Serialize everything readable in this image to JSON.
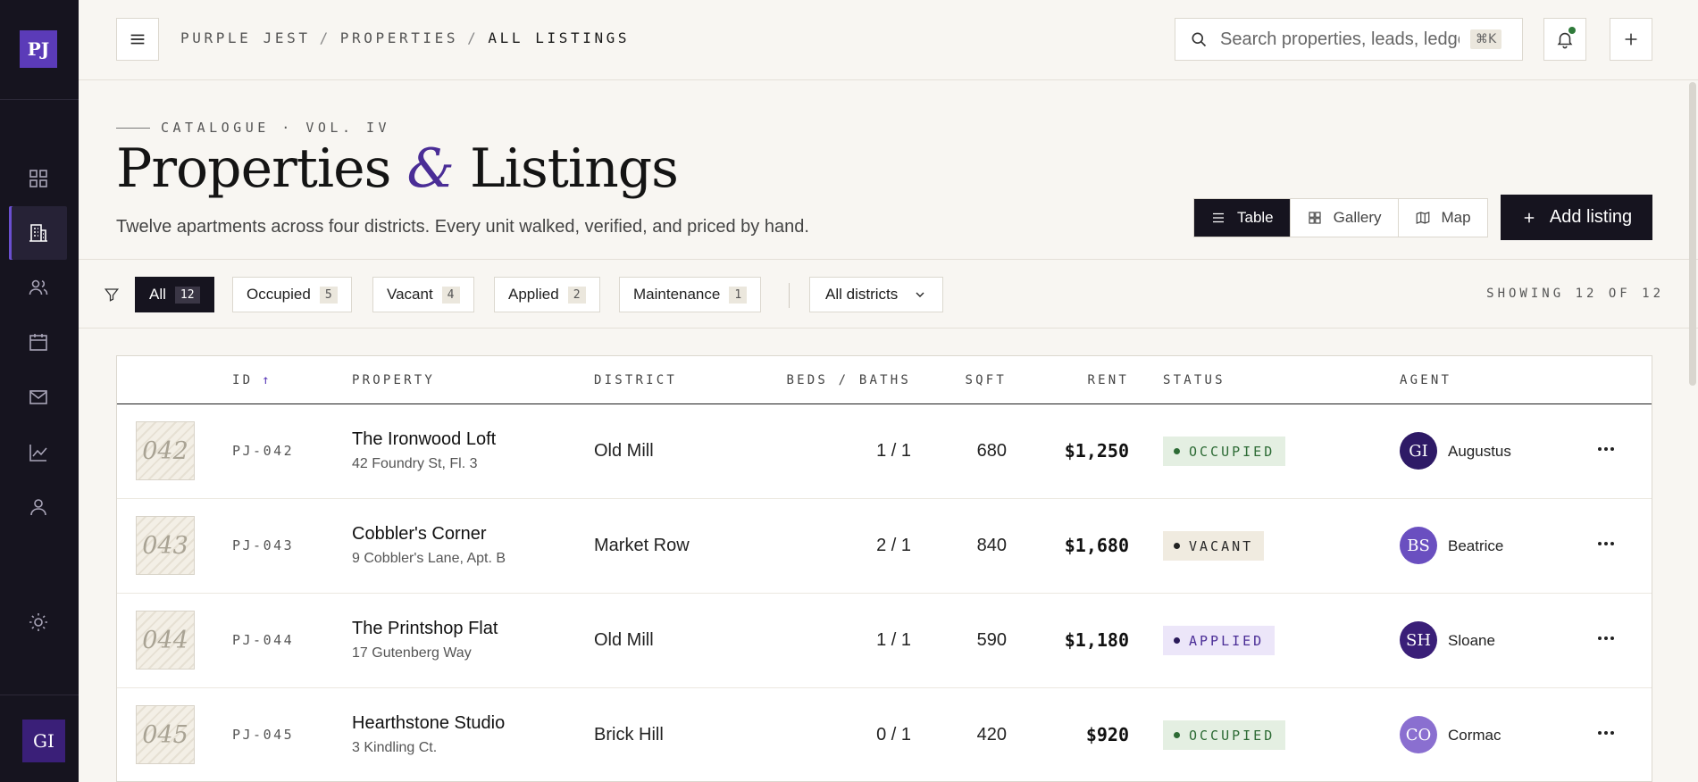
{
  "app": {
    "logo": "PJ",
    "user_initials": "GI"
  },
  "header": {
    "breadcrumb": [
      "PURPLE JEST",
      "PROPERTIES",
      "ALL LISTINGS"
    ],
    "search_placeholder": "Search properties, leads, ledgers…",
    "search_shortcut": "⌘K"
  },
  "page": {
    "kicker": "CATALOGUE · VOL. IV",
    "title_part1": "Properties",
    "title_amp": "&",
    "title_part2": "Listings",
    "subtitle": "Twelve apartments across four districts. Every unit walked, verified, and priced by hand."
  },
  "view_toggle": {
    "options": [
      {
        "label": "Table",
        "icon": "list-icon",
        "active": true
      },
      {
        "label": "Gallery",
        "icon": "grid-icon",
        "active": false
      },
      {
        "label": "Map",
        "icon": "map-icon",
        "active": false
      }
    ]
  },
  "add_button": {
    "label": "Add listing"
  },
  "filters": {
    "chips": [
      {
        "label": "All",
        "count": "12",
        "active": true
      },
      {
        "label": "Occupied",
        "count": "5",
        "active": false
      },
      {
        "label": "Vacant",
        "count": "4",
        "active": false
      },
      {
        "label": "Applied",
        "count": "2",
        "active": false
      },
      {
        "label": "Maintenance",
        "count": "1",
        "active": false
      }
    ],
    "district_selected": "All districts",
    "showing": "SHOWING 12 OF 12"
  },
  "table": {
    "columns": {
      "id": "ID",
      "property": "PROPERTY",
      "district": "DISTRICT",
      "beds_baths": "BEDS / BATHS",
      "sqft": "SQFT",
      "rent": "RENT",
      "status": "STATUS",
      "agent": "AGENT"
    },
    "sort_indicator": "↑",
    "rows": [
      {
        "thumb": "042",
        "id": "PJ-042",
        "name": "The Ironwood Loft",
        "address": "42 Foundry St, Fl. 3",
        "district": "Old Mill",
        "beds_baths": "1 / 1",
        "sqft": "680",
        "rent": "$1,250",
        "status": "OCCUPIED",
        "agent_initials": "GI",
        "agent_name": "Augustus"
      },
      {
        "thumb": "043",
        "id": "PJ-043",
        "name": "Cobbler's Corner",
        "address": "9 Cobbler's Lane, Apt. B",
        "district": "Market Row",
        "beds_baths": "2 / 1",
        "sqft": "840",
        "rent": "$1,680",
        "status": "VACANT",
        "agent_initials": "BS",
        "agent_name": "Beatrice"
      },
      {
        "thumb": "044",
        "id": "PJ-044",
        "name": "The Printshop Flat",
        "address": "17 Gutenberg Way",
        "district": "Old Mill",
        "beds_baths": "1 / 1",
        "sqft": "590",
        "rent": "$1,180",
        "status": "APPLIED",
        "agent_initials": "SH",
        "agent_name": "Sloane"
      },
      {
        "thumb": "045",
        "id": "PJ-045",
        "name": "Hearthstone Studio",
        "address": "3 Kindling Ct.",
        "district": "Brick Hill",
        "beds_baths": "0 / 1",
        "sqft": "420",
        "rent": "$920",
        "status": "OCCUPIED",
        "agent_initials": "CO",
        "agent_name": "Cormac"
      }
    ]
  },
  "colors": {
    "sidebar": "#16141f",
    "accent": "#5b3bb8",
    "occupied": "#2d6b35",
    "applied": "#4a2d96",
    "agent_augustus": "#2e1a66",
    "agent_beatrice": "#6a4fc0",
    "agent_sloane": "#3a1f78",
    "agent_cormac": "#8a6fd0"
  }
}
